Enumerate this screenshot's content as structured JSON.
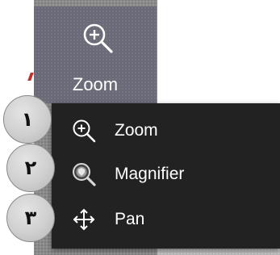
{
  "ribbon": {
    "zoom_button_label": "Zoom"
  },
  "menu": {
    "items": [
      {
        "label": "Zoom",
        "icon": "zoom-icon"
      },
      {
        "label": "Magnifier",
        "icon": "magnifier-icon"
      },
      {
        "label": "Pan",
        "icon": "pan-icon"
      }
    ]
  },
  "badges": [
    "١",
    "٢",
    "٣"
  ],
  "colors": {
    "menu_background": "#222222",
    "ribbon_selected": "#6a6a78",
    "text": "#ffffff",
    "badge": "#cfcfcf"
  }
}
